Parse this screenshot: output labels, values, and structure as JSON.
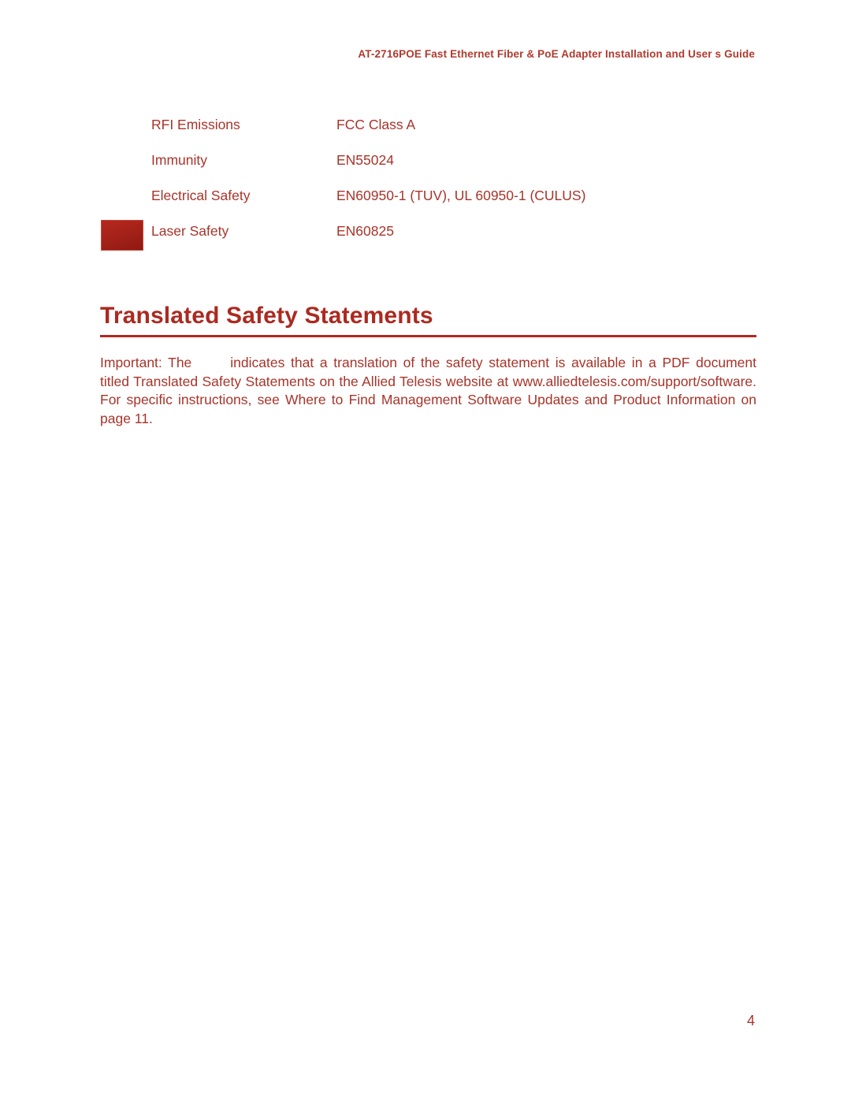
{
  "header": {
    "running_title": "AT-2716POE Fast Ethernet Fiber & PoE Adapter Installation and User s Guide"
  },
  "colors": {
    "text_red": "#a8342a",
    "heading_red": "#ab2a20",
    "rule_red": "#b0291f",
    "marker_red": "#a8231a",
    "page_background": "#ffffff"
  },
  "spec_table": {
    "rows": [
      {
        "label": "RFI Emissions",
        "value": "FCC Class A",
        "marker": false
      },
      {
        "label": "Immunity",
        "value": "EN55024",
        "marker": false
      },
      {
        "label": "Electrical Safety",
        "value": "EN60950-1 (TUV), UL 60950-1 (CULUS)",
        "marker": false
      },
      {
        "label": "Laser Safety",
        "value": "EN60825",
        "marker": true
      }
    ]
  },
  "section": {
    "heading": "Translated Safety Statements"
  },
  "body": {
    "line_1_prefix": "Important:  The",
    "line_1_rest": "indicates that a translation of the safety statement is available in a PDF document  titled  Translated  Safety  Statements  on  the  Allied  Telesis  website  at www.alliedtelesis.com/support/software.  For  specific  instructions,  see  Where  to  Find Management Software Updates and Product Information  on page 11."
  },
  "footer": {
    "page_number": "4"
  }
}
